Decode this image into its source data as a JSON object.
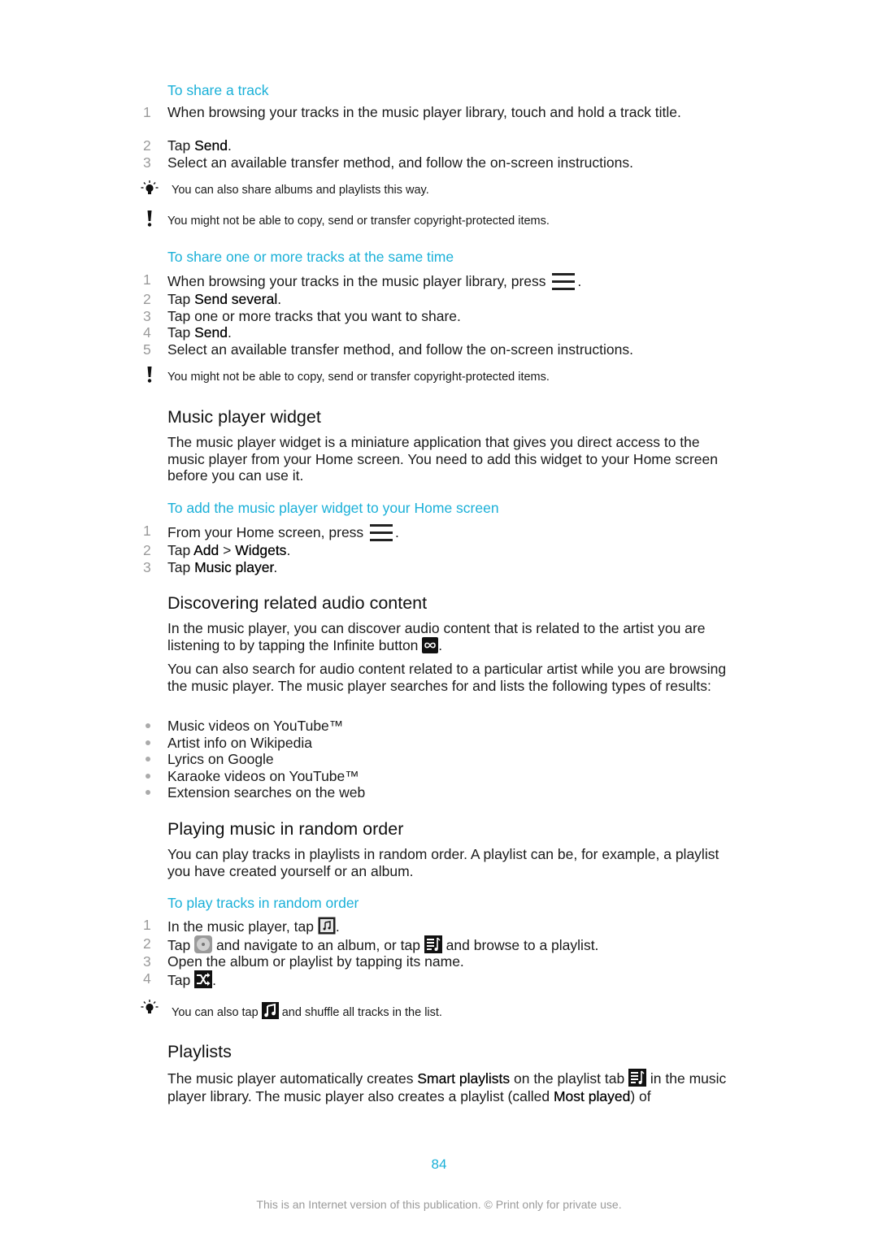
{
  "section_share_track": {
    "heading": "To share a track",
    "steps": [
      {
        "num": "1",
        "pre": "When browsing your tracks in the music player library, touch and hold a track title.",
        "bold": "",
        "post": ""
      },
      {
        "num": "2",
        "pre": "Tap ",
        "bold": "Send",
        "post": "."
      },
      {
        "num": "3",
        "pre": "Select an available transfer method, and follow the on-screen instructions.",
        "bold": "",
        "post": ""
      }
    ],
    "tip": "You can also share albums and playlists this way.",
    "warning": "You might not be able to copy, send or transfer copyright-protected items."
  },
  "section_share_multiple": {
    "heading": "To share one or more tracks at the same time",
    "step1_pre": "When browsing your tracks in the music player library, press ",
    "step1_post": ".",
    "step1_icon": "menu-icon",
    "steps": [
      {
        "num": "1"
      },
      {
        "num": "2",
        "pre": "Tap ",
        "bold": "Send several",
        "post": "."
      },
      {
        "num": "3",
        "pre": "Tap one or more tracks that you want to share.",
        "bold": "",
        "post": ""
      },
      {
        "num": "4",
        "pre": "Tap ",
        "bold": "Send",
        "post": "."
      },
      {
        "num": "5",
        "pre": "Select an available transfer method, and follow the on-screen instructions.",
        "bold": "",
        "post": ""
      }
    ],
    "warning": "You might not be able to copy, send or transfer copyright-protected items."
  },
  "section_widget": {
    "title": "Music player widget",
    "body": "The music player widget is a miniature application that gives you direct access to the music player from your Home screen. You need to add this widget to your Home screen before you can use it.",
    "subheading": "To add the music player widget to your Home screen",
    "step1_pre": "From your Home screen, press ",
    "step1_post": ".",
    "step2": {
      "pre": "Tap ",
      "bold1": "Add",
      "mid": " > ",
      "bold2": "Widgets",
      "post": "."
    },
    "step3": {
      "pre": "Tap ",
      "bold": "Music player",
      "post": "."
    },
    "nums": [
      "1",
      "2",
      "3"
    ]
  },
  "section_discover": {
    "title": "Discovering related audio content",
    "body1_pre": "In the music player, you can discover audio content that is related to the artist you are listening to by tapping the Infinite button ",
    "body1_post": ".",
    "infinite_icon": "infinity-icon",
    "body2": "You can also search for audio content related to a particular artist while you are browsing the music player. The music player searches for and lists the following types of results:",
    "bullets": [
      "Music videos on YouTube™",
      "Artist info on Wikipedia",
      "Lyrics on Google",
      "Karaoke videos on YouTube™",
      "Extension searches on the web"
    ]
  },
  "section_random": {
    "title": "Playing music in random order",
    "body": "You can play tracks in playlists in random order. A playlist can be, for example, a playlist you have created yourself or an album.",
    "subheading": "To play tracks in random order",
    "nums": [
      "1",
      "2",
      "3",
      "4"
    ],
    "step1_pre": "In the music player, tap ",
    "step1_post": ".",
    "step2_a": "Tap ",
    "step2_b": " and navigate to an album, or tap ",
    "step2_c": " and browse to a playlist.",
    "step3": "Open the album or playlist by tapping its name.",
    "step4_pre": "Tap ",
    "step4_post": ".",
    "tip_pre": "You can also tap ",
    "tip_post": " and shuffle all tracks in the list."
  },
  "section_playlists": {
    "title": "Playlists",
    "body_a": "The music player automatically creates ",
    "bold_a": "Smart playlists",
    "body_b": " on the playlist tab ",
    "body_c": " in the music player library. The music player also creates a playlist (called ",
    "bold_b": "Most played",
    "body_d": ") of"
  },
  "footer": {
    "page_number": "84",
    "notice": "This is an Internet version of this publication. © Print only for private use."
  },
  "colors": {
    "accent": "#1ab0d8",
    "text": "#1a1a1a",
    "muted": "#9a9a9a"
  }
}
